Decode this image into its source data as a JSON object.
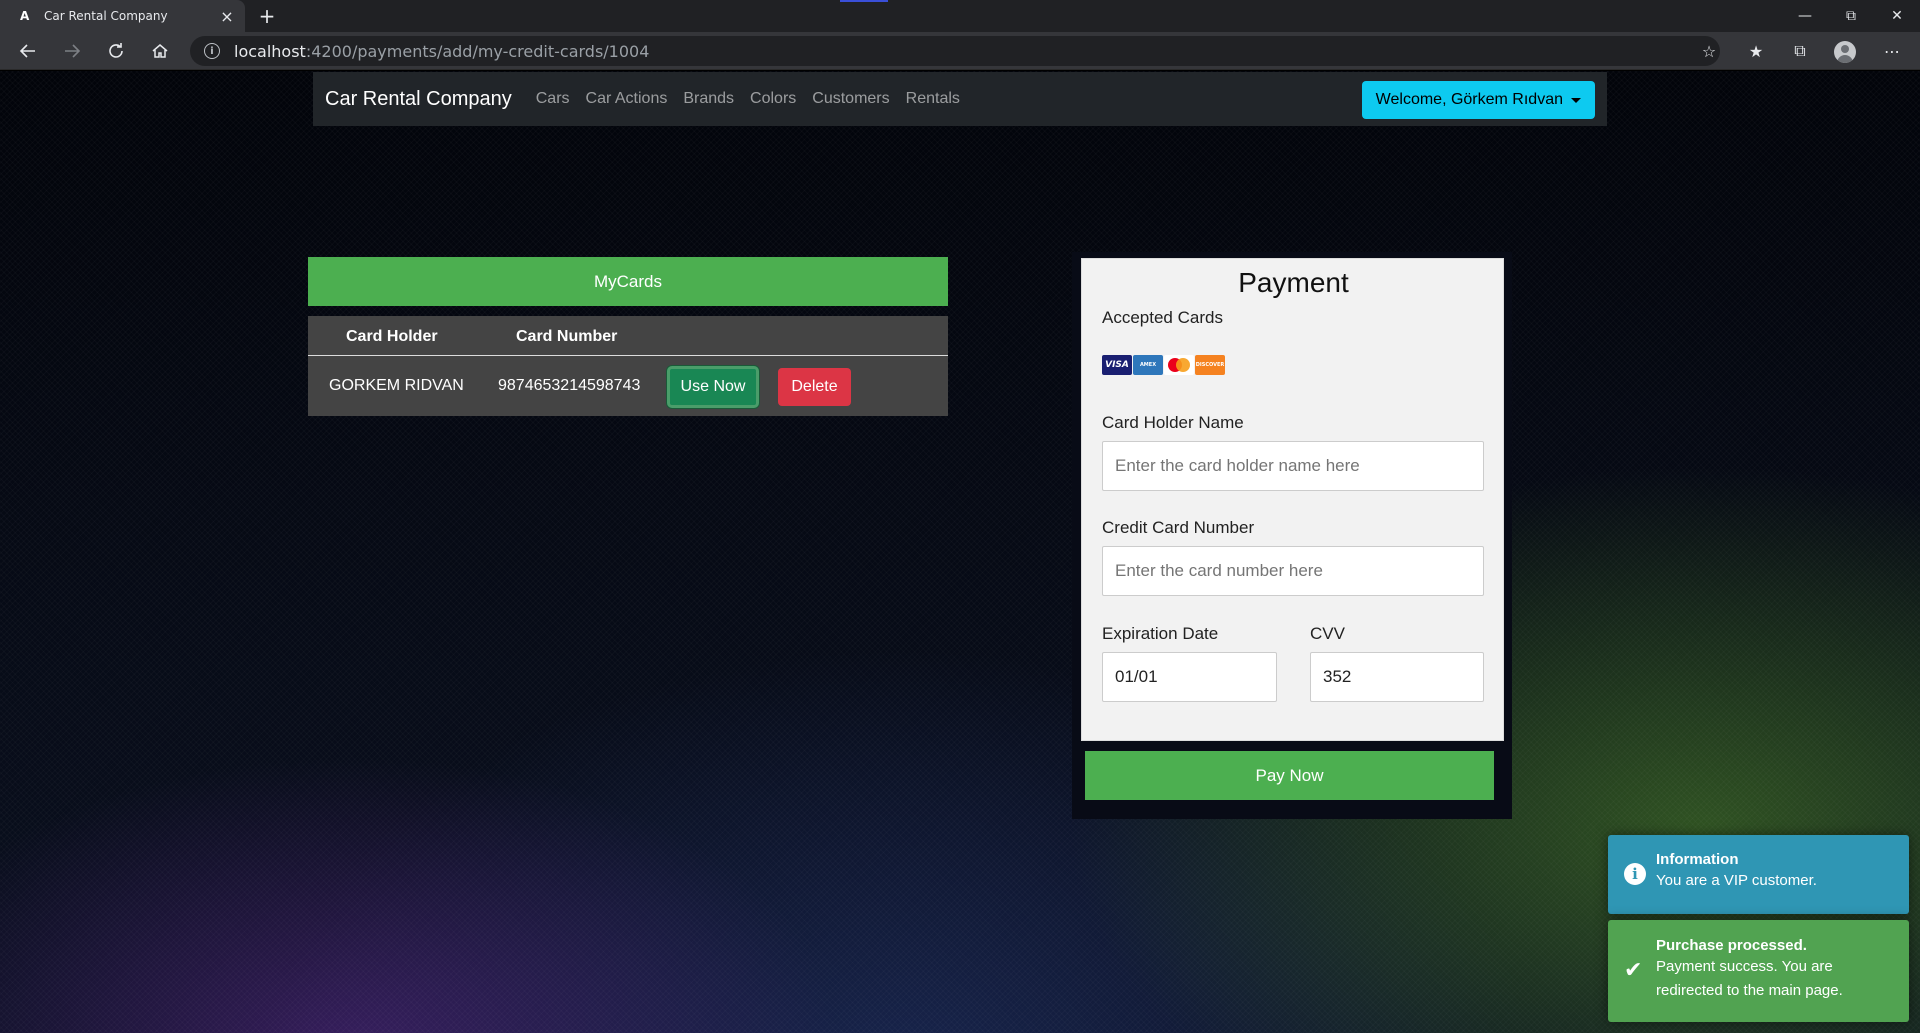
{
  "browser": {
    "tab_title": "Car Rental Company",
    "tab_favicon": "A",
    "tab_close": "×",
    "new_tab": "+",
    "url_host": "localhost",
    "url_path": ":4200/payments/add/my-credit-cards/1004"
  },
  "navbar": {
    "brand": "Car Rental Company",
    "links": [
      "Cars",
      "Car Actions",
      "Brands",
      "Colors",
      "Customers",
      "Rentals"
    ],
    "welcome": "Welcome, Görkem Rıdvan"
  },
  "mycards": {
    "button_label": "MyCards",
    "columns": [
      "Card Holder",
      "Card Number"
    ],
    "rows": [
      {
        "holder": "GORKEM RIDVAN",
        "number": "9874653214598743",
        "use_label": "Use Now",
        "delete_label": "Delete"
      }
    ]
  },
  "payment": {
    "title": "Payment",
    "accepted_label": "Accepted Cards",
    "accepted_icons": [
      "visa-icon",
      "amex-icon",
      "mastercard-icon",
      "discover-icon"
    ],
    "holder_label": "Card Holder Name",
    "holder_placeholder": "Enter the card holder name here",
    "number_label": "Credit Card Number",
    "number_placeholder": "Enter the card number here",
    "expiration_label": "Expiration Date",
    "expiration_value": "01/01",
    "cvv_label": "CVV",
    "cvv_value": "352",
    "pay_label": "Pay Now"
  },
  "toasts": [
    {
      "type": "info",
      "title": "Information",
      "message": "You are a VIP customer."
    },
    {
      "type": "success",
      "title": "Purchase processed.",
      "message": "Payment success. You are redirected to the main page."
    }
  ],
  "colors": {
    "primary_green": "#4caf50",
    "success_dark": "#198754",
    "danger": "#dc3545",
    "info_button": "#0dcaf0",
    "toast_info": "#2f96b4",
    "toast_success": "#51a351"
  }
}
